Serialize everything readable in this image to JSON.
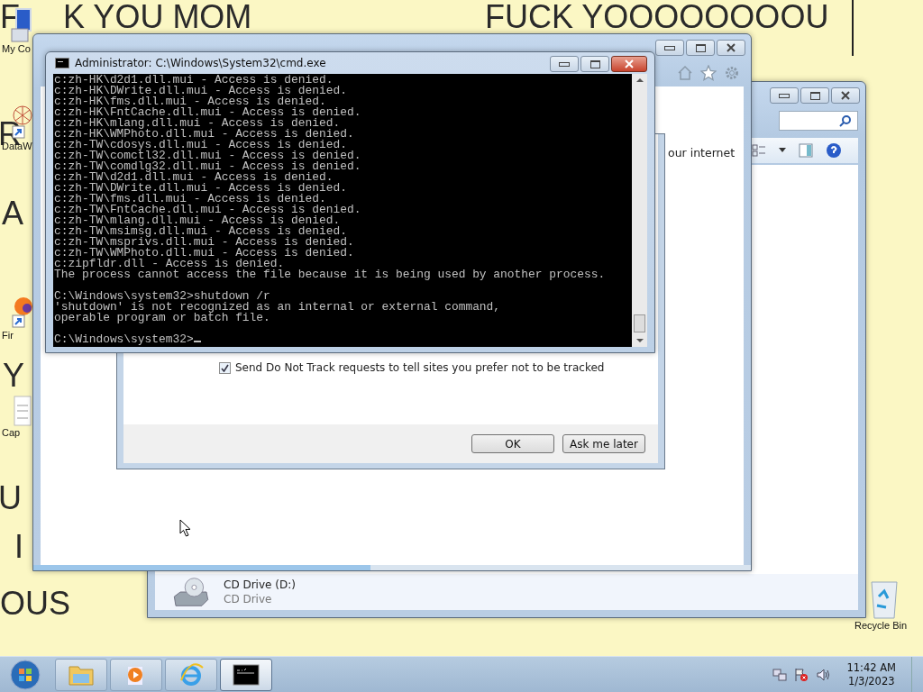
{
  "wallpaper_texts": [
    {
      "text": "F"
    },
    {
      "text": "K YOU MOM"
    },
    {
      "text": "FUCK YOOOOOOOOU"
    },
    {
      "text": "R"
    },
    {
      "text": "A"
    },
    {
      "text": "Y"
    },
    {
      "text": "U"
    },
    {
      "text": "I"
    },
    {
      "text": "OUS"
    }
  ],
  "desktop_icons": [
    {
      "kind": "computer",
      "label": "My Co"
    },
    {
      "kind": "shortcut",
      "label": "DataW"
    },
    {
      "kind": "firefox",
      "label": "Fir"
    },
    {
      "kind": "document",
      "label": "Cap"
    },
    {
      "kind": "recycle",
      "label": "Recycle Bin"
    }
  ],
  "explorer": {
    "drives": [
      {
        "name": "CD Drive (D:)",
        "type": "CD Drive"
      }
    ]
  },
  "browser": {
    "partial_text": "our internet",
    "progress": {
      "level": 0.47
    },
    "dialog": {
      "checkbox": {
        "label": "Send Do Not Track requests to tell sites you prefer not to be tracked",
        "checked": true
      },
      "buttons": [
        "OK",
        "Ask me later"
      ]
    }
  },
  "console": {
    "title": "Administrator: C:\\Windows\\System32\\cmd.exe",
    "blocks": [
      [
        "c:zh-HK\\d2d1.dll.mui - Access is denied.",
        "c:zh-HK\\DWrite.dll.mui - Access is denied.",
        "c:zh-HK\\fms.dll.mui - Access is denied.",
        "c:zh-HK\\FntCache.dll.mui - Access is denied.",
        "c:zh-HK\\mlang.dll.mui - Access is denied.",
        "c:zh-HK\\WMPhoto.dll.mui - Access is denied.",
        "c:zh-TW\\cdosys.dll.mui - Access is denied.",
        "c:zh-TW\\comctl32.dll.mui - Access is denied.",
        "c:zh-TW\\comdlg32.dll.mui - Access is denied.",
        "c:zh-TW\\d2d1.dll.mui - Access is denied.",
        "c:zh-TW\\DWrite.dll.mui - Access is denied.",
        "c:zh-TW\\fms.dll.mui - Access is denied.",
        "c:zh-TW\\FntCache.dll.mui - Access is denied.",
        "c:zh-TW\\mlang.dll.mui - Access is denied.",
        "c:zh-TW\\msimsg.dll.mui - Access is denied.",
        "c:zh-TW\\msprivs.dll.mui - Access is denied.",
        "c:zh-TW\\WMPhoto.dll.mui - Access is denied.",
        "c:zipfldr.dll - Access is denied.",
        "The process cannot access the file because it is being used by another process."
      ],
      [
        "C:\\Windows\\system32>shutdown /r",
        "'shutdown' is not recognized as an internal or external command,",
        "operable program or batch file."
      ]
    ],
    "prompt": "C:\\Windows\\system32>"
  },
  "taskbar": {
    "buttons": [
      {
        "kind": "folder",
        "selected": false
      },
      {
        "kind": "media",
        "selected": false
      },
      {
        "kind": "browser",
        "selected": false
      },
      {
        "kind": "console",
        "selected": true
      }
    ],
    "clock": {
      "time": "11:42 AM",
      "date": "1/3/2023"
    }
  }
}
